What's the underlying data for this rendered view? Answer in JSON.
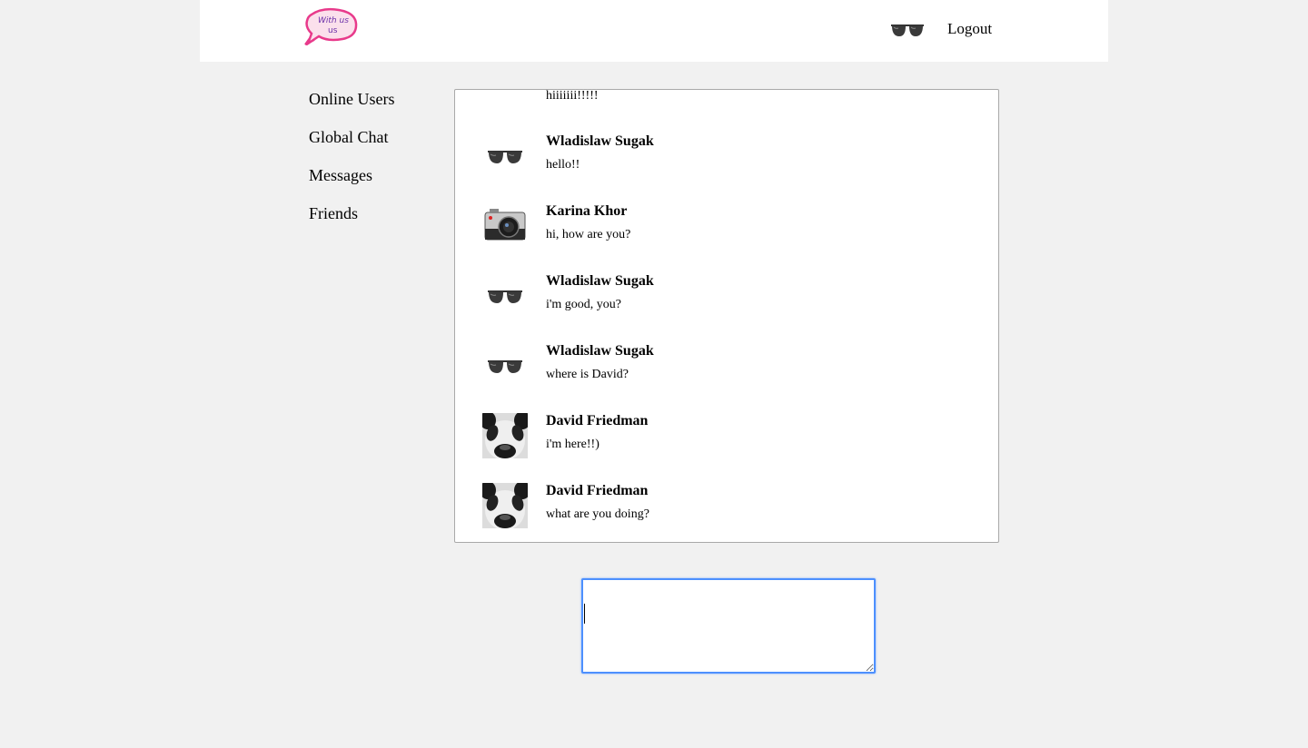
{
  "header": {
    "logo_text": "With us",
    "logout_label": "Logout",
    "user_avatar_icon": "sunglasses-icon"
  },
  "sidebar": {
    "items": [
      {
        "label": "Online Users"
      },
      {
        "label": "Global Chat"
      },
      {
        "label": "Messages"
      },
      {
        "label": "Friends"
      }
    ]
  },
  "chat": {
    "partial_message": "hiiiiiii!!!!!",
    "messages": [
      {
        "name": "Wladislaw Sugak",
        "text": "hello!!",
        "avatar": "sunglasses-icon"
      },
      {
        "name": "Karina Khor",
        "text": "hi, how are you?",
        "avatar": "camera-icon"
      },
      {
        "name": "Wladislaw Sugak",
        "text": "i'm good, you?",
        "avatar": "sunglasses-icon"
      },
      {
        "name": "Wladislaw Sugak",
        "text": "where is David?",
        "avatar": "sunglasses-icon"
      },
      {
        "name": "David Friedman",
        "text": "i'm here!!)",
        "avatar": "panda-icon"
      },
      {
        "name": "David Friedman",
        "text": "what are you doing?",
        "avatar": "panda-icon"
      }
    ]
  },
  "compose": {
    "value": ""
  },
  "colors": {
    "background": "#f1f1f1",
    "focus_ring": "#4d90fe"
  }
}
